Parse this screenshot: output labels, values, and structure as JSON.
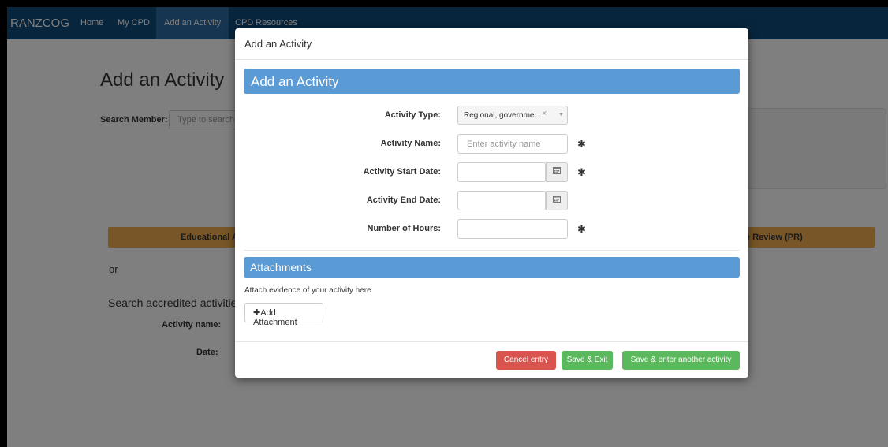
{
  "navbar": {
    "brand": "RANZCOG",
    "items": [
      {
        "label": "Home"
      },
      {
        "label": "My CPD"
      },
      {
        "label": "Add an Activity"
      },
      {
        "label": "CPD Resources"
      }
    ]
  },
  "page": {
    "title": "Add an Activity",
    "search_label": "Search Member:",
    "search_placeholder": "Type to search",
    "edu_bar_left": "Educational A",
    "edu_bar_right": "e Review (PR)",
    "or_text": "or",
    "accredited_title": "Search accredited activities",
    "activity_name_label": "Activity name:",
    "date_label": "Date:"
  },
  "modal": {
    "title": "Add an Activity",
    "section_title": "Add an Activity",
    "form": {
      "activity_type_label": "Activity Type:",
      "activity_type_value": "Regional, governme...",
      "activity_type_clear": "×",
      "activity_type_caret": "▼",
      "activity_name_label": "Activity Name:",
      "activity_name_placeholder": "Enter activity name",
      "start_date_label": "Activity Start Date:",
      "end_date_label": "Activity End Date:",
      "hours_label": "Number of Hours:",
      "required_marker": "✱"
    },
    "attachments": {
      "title": "Attachments",
      "help_text": "Attach evidence of your activity here",
      "add_button": "✚Add Attachment"
    },
    "footer": {
      "cancel": "Cancel entry",
      "save_exit": "Save & Exit",
      "save_another": "Save & enter another activity"
    }
  },
  "colors": {
    "navbar": "#0e4a7b",
    "section_header": "#5b9bd5",
    "warning_bar": "#f0ad4e",
    "danger": "#d9534f",
    "success": "#5cb85c"
  },
  "icons": {
    "calendar": "calendar-icon"
  }
}
